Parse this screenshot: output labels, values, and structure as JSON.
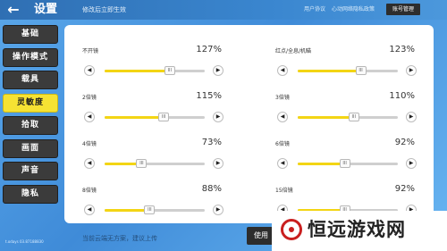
{
  "header": {
    "back_icon": "arrow-left-icon",
    "title": "设置",
    "subtitle": "修改后立即生效",
    "user_agreement": "用户协议",
    "privacy_agreement": "心动网络隐私政策",
    "account_button": "账号管理"
  },
  "sidebar": {
    "items": [
      {
        "label": "基础",
        "active": false
      },
      {
        "label": "操作模式",
        "active": false
      },
      {
        "label": "载具",
        "active": false
      },
      {
        "label": "灵敏度",
        "active": true
      },
      {
        "label": "拾取",
        "active": false
      },
      {
        "label": "画面",
        "active": false
      },
      {
        "label": "声音",
        "active": false
      },
      {
        "label": "隐私",
        "active": false
      }
    ]
  },
  "sensitivity": {
    "minus_icon": "triangle-left-icon",
    "plus_icon": "triangle-right-icon",
    "thumb_symbol": "III",
    "items": [
      {
        "label": "不开镜",
        "value": "127%",
        "fill": 0.65
      },
      {
        "label": "红点/全息/机瞄",
        "value": "123%",
        "fill": 0.63
      },
      {
        "label": "2倍镜",
        "value": "115%",
        "fill": 0.59
      },
      {
        "label": "3倍镜",
        "value": "110%",
        "fill": 0.56
      },
      {
        "label": "4倍镜",
        "value": "73%",
        "fill": 0.37
      },
      {
        "label": "6倍镜",
        "value": "92%",
        "fill": 0.47
      },
      {
        "label": "8倍镜",
        "value": "88%",
        "fill": 0.45
      },
      {
        "label": "15倍镜",
        "value": "92%",
        "fill": 0.47
      }
    ]
  },
  "footer": {
    "note": "当前云端无方案，建议上传",
    "version": "t.odays 03.87188830",
    "use_button": "使用"
  },
  "watermark": {
    "text": "恒远游戏网"
  },
  "colors": {
    "accent": "#f6e233",
    "track": "#cfcfcf",
    "fill": "#f3d514",
    "dark_button": "#2d2d2d"
  }
}
